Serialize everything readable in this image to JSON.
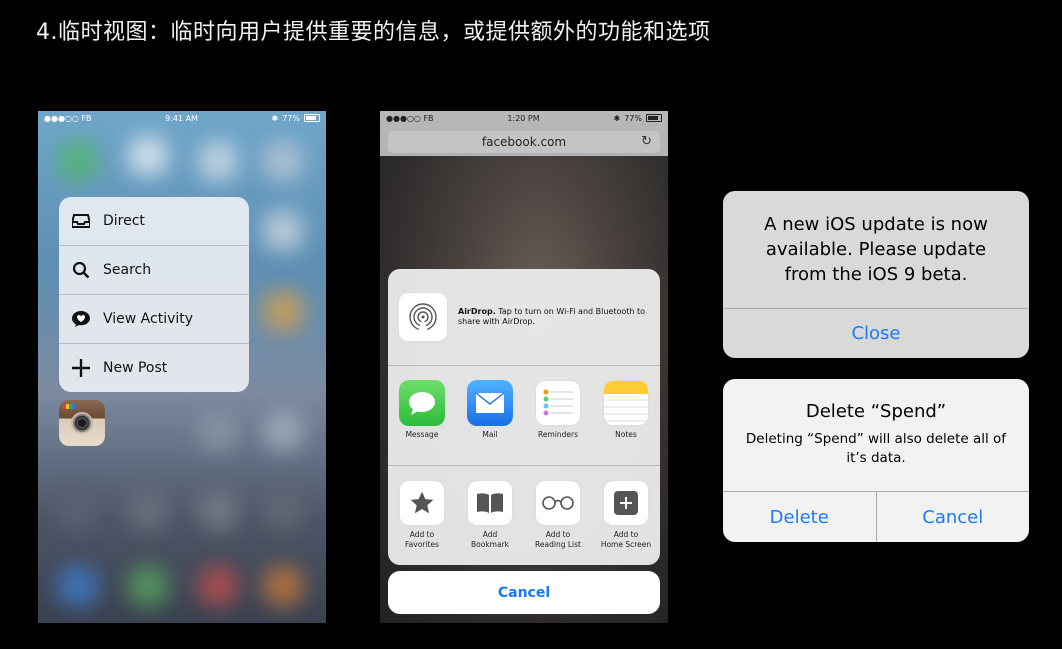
{
  "slide": {
    "title": "4.临时视图：临时向用户提供重要的信息，或提供额外的功能和选项"
  },
  "phone1": {
    "status": {
      "carrier": "●●●○○ FB",
      "time": "9:41 AM",
      "battery": "77%"
    },
    "menu_items": [
      {
        "label": "Direct",
        "icon": "inbox-tray-icon"
      },
      {
        "label": "Search",
        "icon": "search-icon"
      },
      {
        "label": "View Activity",
        "icon": "heart-bubble-icon"
      },
      {
        "label": "New Post",
        "icon": "plus-icon"
      }
    ],
    "app_icon": "instagram-app-icon"
  },
  "phone2": {
    "status": {
      "carrier": "●●●○○ FB",
      "time": "1:20 PM",
      "battery": "77%"
    },
    "url": "facebook.com",
    "airdrop": {
      "title": "AirDrop.",
      "text": "Tap to turn on Wi-Fi and Bluetooth to share with AirDrop."
    },
    "share_apps": [
      {
        "label": "Message",
        "icon": "message-icon"
      },
      {
        "label": "Mail",
        "icon": "mail-icon"
      },
      {
        "label": "Reminders",
        "icon": "reminders-icon"
      },
      {
        "label": "Notes",
        "icon": "notes-icon"
      }
    ],
    "actions": [
      {
        "line1": "Add to",
        "line2": "Favorites",
        "icon": "star-icon"
      },
      {
        "line1": "Add",
        "line2": "Bookmark",
        "icon": "book-icon"
      },
      {
        "line1": "Add to",
        "line2": "Reading List",
        "icon": "glasses-icon"
      },
      {
        "line1": "Add to",
        "line2": "Home Screen",
        "icon": "plus-square-icon"
      }
    ],
    "cancel": "Cancel"
  },
  "alert_update": {
    "message": "A new iOS update is now available. Please update from the iOS 9 beta.",
    "button": "Close"
  },
  "alert_delete": {
    "title": "Delete “Spend”",
    "message": "Deleting “Spend” will also delete all of it’s data.",
    "delete": "Delete",
    "cancel": "Cancel"
  },
  "colors": {
    "ios_blue": "#1c7cf0",
    "background": "#000000"
  }
}
